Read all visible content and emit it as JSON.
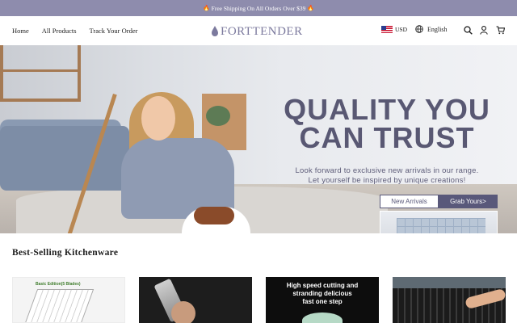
{
  "announcement": {
    "text": "Free Shipping On All Orders Over $39",
    "icon": "fire-icon"
  },
  "header": {
    "nav": [
      "Home",
      "All Products",
      "Track Your Order"
    ],
    "logo_text": "FORTTENDER",
    "currency": "USD",
    "language": "English",
    "icons": [
      "search-icon",
      "account-icon",
      "cart-icon"
    ]
  },
  "hero": {
    "title_line1": "QUALITY YOU",
    "title_line2": "CAN TRUST",
    "subtitle_line1": "Look forward to exclusive new arrivals in our range.",
    "subtitle_line2": "Let yourself be inspired by unique creations!",
    "btn_new": "New Arrivals",
    "btn_grab": "Grab Yours>"
  },
  "section": {
    "title": "Best-Selling Kitchenware",
    "products": [
      {
        "label": "Basic Edition(5 Blades)"
      },
      {
        "label": ""
      },
      {
        "label_line1": "High speed cutting and",
        "label_line2": "stranding delicious",
        "label_line3": "fast one step"
      },
      {
        "label": ""
      }
    ]
  },
  "colors": {
    "announcement_bg": "#8e8cad",
    "accent": "#59587a",
    "logo": "#7c7a9e"
  }
}
